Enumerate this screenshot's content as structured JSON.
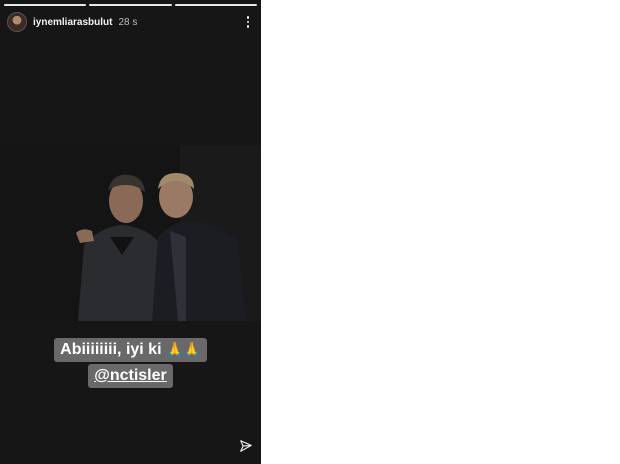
{
  "story": {
    "progress_segments": 3,
    "active_segment": 3,
    "username": "iynemliarasbulut",
    "timestamp": "28 s",
    "caption_line1": "Abiiiiiiii, iyi ki",
    "caption_emoji": "🙏🙏",
    "caption_mention": "@nctisler",
    "icons": {
      "menu": "more-vertical-icon",
      "send": "send-icon"
    },
    "colors": {
      "background": "#161616",
      "caption_bg": "#787878"
    }
  }
}
